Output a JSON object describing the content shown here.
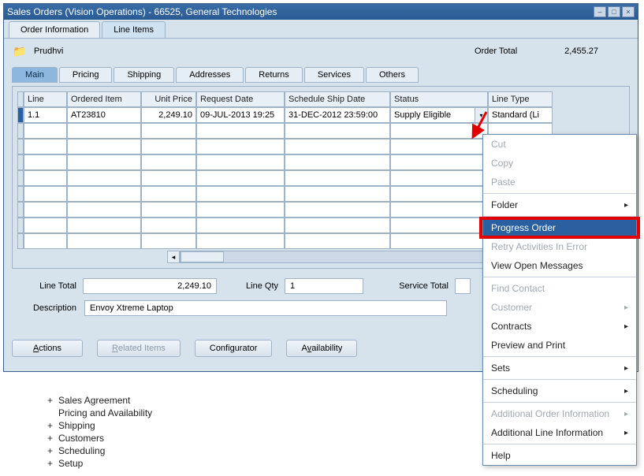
{
  "window_title": "Sales Orders (Vision Operations) - 66525, General Technologies",
  "tabs": {
    "order_info": "Order Information",
    "line_items": "Line Items"
  },
  "folder_name": "Prudhvi",
  "order_total_label": "Order Total",
  "order_total_value": "2,455.27",
  "subtabs": [
    "Main",
    "Pricing",
    "Shipping",
    "Addresses",
    "Returns",
    "Services",
    "Others"
  ],
  "grid": {
    "headers": {
      "line": "Line",
      "ordered_item": "Ordered Item",
      "unit_price": "Unit Price",
      "request_date": "Request Date",
      "schedule": "Schedule Ship Date",
      "status": "Status",
      "line_type": "Line Type"
    },
    "row": {
      "line": "1.1",
      "ordered_item": "AT23810",
      "unit_price": "2,249.10",
      "request_date": "09-JUL-2013 19:25",
      "schedule": "31-DEC-2012 23:59:00",
      "status": "Supply Eligible",
      "line_type": "Standard (Li"
    }
  },
  "totals": {
    "line_total_label": "Line Total",
    "line_total_value": "2,249.10",
    "line_qty_label": "Line Qty",
    "line_qty_value": "1",
    "service_total_label": "Service Total",
    "description_label": "Description",
    "description_value": "Envoy Xtreme Laptop"
  },
  "buttons": {
    "actions": "Actions",
    "related": "Related Items",
    "configurator": "Configurator",
    "availability": "Availability"
  },
  "tree_items": {
    "sales_agreement": "Sales Agreement",
    "pricing": "Pricing and Availability",
    "shipping": "Shipping",
    "customers": "Customers",
    "scheduling": "Scheduling",
    "setup": "Setup"
  },
  "context_menu": {
    "cut": "Cut",
    "copy": "Copy",
    "paste": "Paste",
    "folder": "Folder",
    "progress_order": "Progress Order",
    "retry": "Retry Activities In Error",
    "view_open": "View Open Messages",
    "find_contact": "Find Contact",
    "customer": "Customer",
    "contracts": "Contracts",
    "preview_print": "Preview and Print",
    "sets": "Sets",
    "scheduling": "Scheduling",
    "addl_order": "Additional Order Information",
    "addl_line": "Additional Line Information",
    "help": "Help"
  }
}
